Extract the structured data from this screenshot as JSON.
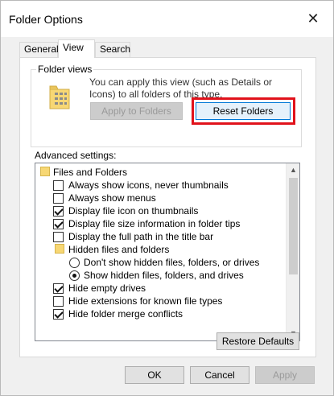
{
  "window": {
    "title": "Folder Options",
    "close_glyph": "✕"
  },
  "tabs": [
    "General",
    "View",
    "Search"
  ],
  "folder_views": {
    "group_title": "Folder views",
    "description": "You can apply this view (such as Details or Icons) to all folders of this type.",
    "apply_button": "Apply to Folders",
    "reset_button": "Reset Folders"
  },
  "advanced": {
    "label": "Advanced settings:",
    "items": [
      {
        "type": "folder",
        "label": "Files and Folders"
      },
      {
        "type": "checkbox",
        "checked": false,
        "label": "Always show icons, never thumbnails"
      },
      {
        "type": "checkbox",
        "checked": false,
        "label": "Always show menus"
      },
      {
        "type": "checkbox",
        "checked": true,
        "label": "Display file icon on thumbnails"
      },
      {
        "type": "checkbox",
        "checked": true,
        "label": "Display file size information in folder tips"
      },
      {
        "type": "checkbox",
        "checked": false,
        "label": "Display the full path in the title bar"
      },
      {
        "type": "folder",
        "label": "Hidden files and folders"
      },
      {
        "type": "radio",
        "checked": false,
        "label": "Don't show hidden files, folders, or drives"
      },
      {
        "type": "radio",
        "checked": true,
        "label": "Show hidden files, folders, and drives"
      },
      {
        "type": "checkbox",
        "checked": true,
        "label": "Hide empty drives"
      },
      {
        "type": "checkbox",
        "checked": false,
        "label": "Hide extensions for known file types"
      },
      {
        "type": "checkbox",
        "checked": true,
        "label": "Hide folder merge conflicts"
      }
    ]
  },
  "buttons": {
    "restore_defaults": "Restore Defaults",
    "ok": "OK",
    "cancel": "Cancel",
    "apply": "Apply"
  },
  "colors": {
    "highlight": "#e1121b",
    "accent": "#0078d7",
    "folder": "#f7d774"
  }
}
